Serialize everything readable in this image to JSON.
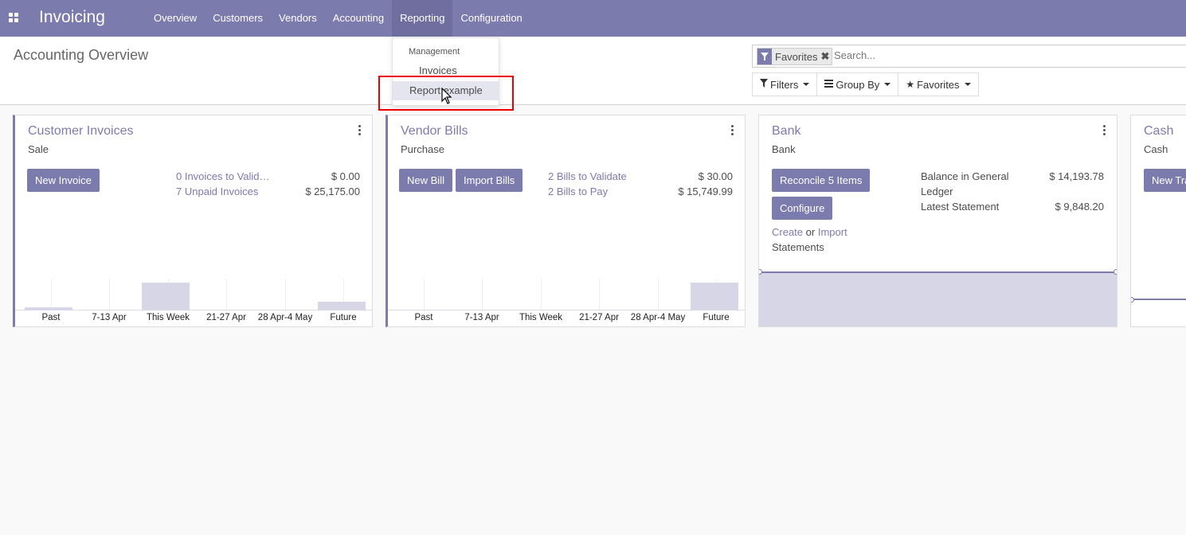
{
  "app": {
    "name": "Invoicing"
  },
  "menu": [
    {
      "label": "Overview"
    },
    {
      "label": "Customers"
    },
    {
      "label": "Vendors"
    },
    {
      "label": "Accounting"
    },
    {
      "label": "Reporting",
      "active": true
    },
    {
      "label": "Configuration"
    }
  ],
  "dropdown": {
    "header": "Management",
    "items": [
      {
        "label": "Invoices"
      },
      {
        "label": "Report example"
      }
    ]
  },
  "page": {
    "title": "Accounting Overview"
  },
  "search": {
    "facet": "Favorites",
    "remove_icon": "✖",
    "placeholder": "Search..."
  },
  "buttons": {
    "filters": "Filters",
    "group_by": "Group By",
    "favorites": "Favorites"
  },
  "cards": {
    "customer": {
      "title": "Customer Invoices",
      "subtitle": "Sale",
      "button": "New Invoice",
      "stats": [
        {
          "label": "0 Invoices to Valid…",
          "value": "$ 0.00"
        },
        {
          "label": "7 Unpaid Invoices",
          "value": "$ 25,175.00"
        }
      ],
      "graph_labels": [
        "Past",
        "7-13 Apr",
        "This Week",
        "21-27 Apr",
        "28 Apr-4 May",
        "Future"
      ],
      "graph_values": [
        0.1,
        0.03,
        1.0,
        0.02,
        0.02,
        0.3
      ]
    },
    "vendor": {
      "title": "Vendor Bills",
      "subtitle": "Purchase",
      "button1": "New Bill",
      "button2": "Import Bills",
      "stats": [
        {
          "label": "2 Bills to Validate",
          "value": "$ 30.00"
        },
        {
          "label": "2 Bills to Pay",
          "value": "$ 15,749.99"
        }
      ],
      "graph_labels": [
        "Past",
        "7-13 Apr",
        "This Week",
        "21-27 Apr",
        "28 Apr-4 May",
        "Future"
      ],
      "graph_values": [
        0.02,
        0.02,
        0.02,
        0.02,
        0.02,
        1.0
      ]
    },
    "bank": {
      "title": "Bank",
      "subtitle": "Bank",
      "button1": "Reconcile 5 Items",
      "button2": "Configure",
      "create": "Create",
      "or": "or",
      "import": "Import",
      "statements": "Statements",
      "balance_label_1": "Balance in General",
      "balance_label_2": "Ledger",
      "balance_value": "$ 14,193.78",
      "latest_label": "Latest Statement",
      "latest_value": "$ 9,848.20"
    },
    "cash": {
      "title": "Cash",
      "subtitle": "Cash",
      "button": "New Transaction"
    }
  },
  "colors": {
    "brand": "#7c7bad",
    "highlight": "#e00000",
    "bar": "#d7d6e7"
  }
}
